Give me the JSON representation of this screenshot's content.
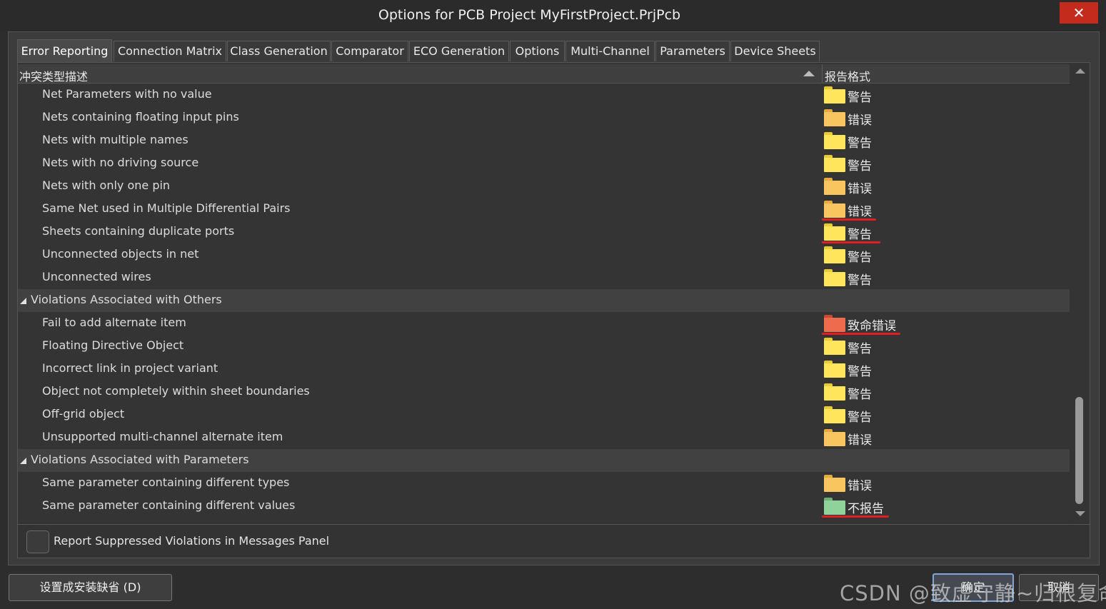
{
  "window": {
    "title": "Options for PCB Project MyFirstProject.PrjPcb",
    "close_glyph": "✕"
  },
  "tabs": [
    {
      "label": "Error Reporting",
      "active": true
    },
    {
      "label": "Connection Matrix"
    },
    {
      "label": "Class Generation"
    },
    {
      "label": "Comparator"
    },
    {
      "label": "ECO Generation"
    },
    {
      "label": "Options"
    },
    {
      "label": "Multi-Channel"
    },
    {
      "label": "Parameters"
    },
    {
      "label": "Device Sheets"
    }
  ],
  "grid": {
    "columns": [
      "冲突类型描述",
      "报告格式"
    ],
    "rows": [
      {
        "label": "Net Parameters with no value",
        "value": "警告",
        "level": "warning"
      },
      {
        "label": "Nets containing floating input pins",
        "value": "错误",
        "level": "error"
      },
      {
        "label": "Nets with multiple names",
        "value": "警告",
        "level": "warning"
      },
      {
        "label": "Nets with no driving source",
        "value": "警告",
        "level": "warning"
      },
      {
        "label": "Nets with only one pin",
        "value": "错误",
        "level": "error"
      },
      {
        "label": "Same Net used in Multiple Differential Pairs",
        "value": "错误",
        "level": "error",
        "underlined": true
      },
      {
        "label": "Sheets containing duplicate ports",
        "value": "警告",
        "level": "warning",
        "underlined": true
      },
      {
        "label": "Unconnected objects in net",
        "value": "警告",
        "level": "warning"
      },
      {
        "label": "Unconnected wires",
        "value": "警告",
        "level": "warning"
      },
      {
        "label": "Violations Associated with Others",
        "group": true
      },
      {
        "label": "Fail to add alternate item",
        "value": "致命错误",
        "level": "fatal",
        "underlined": true
      },
      {
        "label": "Floating Directive Object",
        "value": "警告",
        "level": "warning"
      },
      {
        "label": "Incorrect link in project variant",
        "value": "警告",
        "level": "warning"
      },
      {
        "label": "Object not completely within sheet boundaries",
        "value": "警告",
        "level": "warning"
      },
      {
        "label": "Off-grid object",
        "value": "警告",
        "level": "warning"
      },
      {
        "label": "Unsupported multi-channel alternate item",
        "value": "错误",
        "level": "error"
      },
      {
        "label": "Violations Associated with Parameters",
        "group": true
      },
      {
        "label": "Same parameter containing different types",
        "value": "错误",
        "level": "error"
      },
      {
        "label": "Same parameter containing different values",
        "value": "不报告",
        "level": "none",
        "underlined": true
      }
    ]
  },
  "level_colors": {
    "warning": {
      "tab": "#e9c934",
      "body": "#ffe55c"
    },
    "error": {
      "tab": "#e7a83e",
      "body": "#f8c55f"
    },
    "fatal": {
      "tab": "#c94b32",
      "body": "#ee6c4d"
    },
    "none": {
      "tab": "#6fae77",
      "body": "#8fd29a"
    }
  },
  "annotation_color": "#e01e24",
  "checkbox": {
    "label": "Report Suppressed Violations in Messages Panel",
    "checked": false
  },
  "buttons": {
    "set_default": "设置成安装缺省 (D)",
    "ok": "确定",
    "cancel": "取消"
  },
  "watermark": "CSDN @致虚守静~归根复命"
}
